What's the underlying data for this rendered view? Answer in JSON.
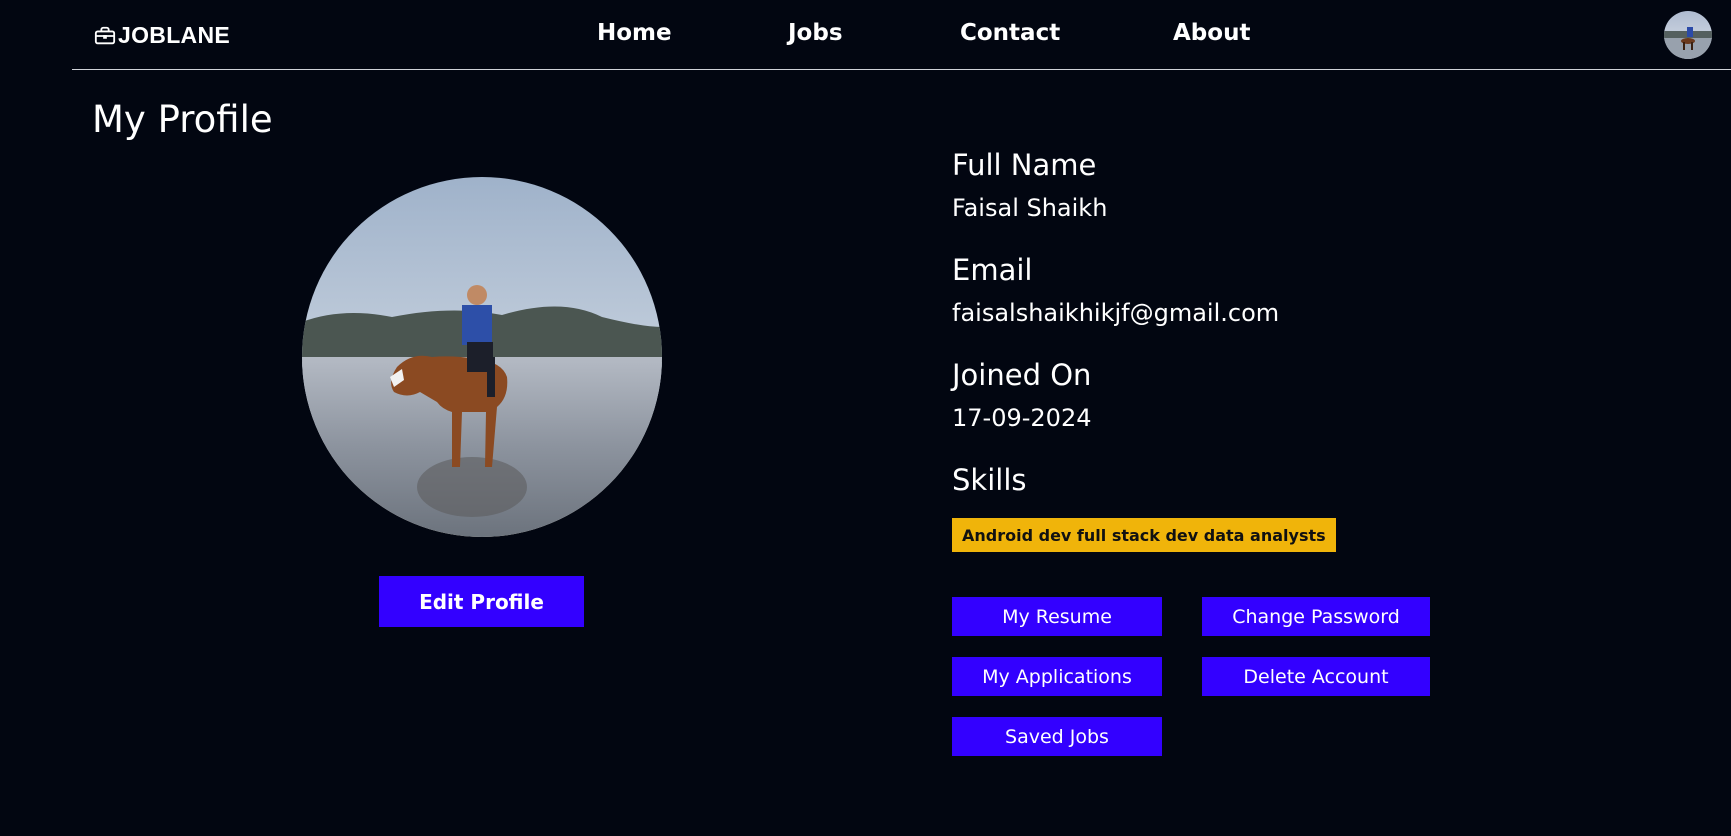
{
  "nav": {
    "brand": "JOBLANE",
    "links": [
      "Home",
      "Jobs",
      "Contact",
      "About"
    ]
  },
  "page": {
    "title": "My Profile"
  },
  "profile": {
    "fields": [
      {
        "label": "Full Name",
        "value": "Faisal Shaikh"
      },
      {
        "label": "Email",
        "value": "faisalshaikhikjf@gmail.com"
      },
      {
        "label": "Joined On",
        "value": "17-09-2024"
      }
    ],
    "skills_label": "Skills",
    "skills": [
      "Android dev full stack dev data analysts"
    ]
  },
  "buttons": {
    "edit_profile": "Edit Profile",
    "my_resume": "My Resume",
    "change_password": "Change Password",
    "my_applications": "My Applications",
    "delete_account": "Delete Account",
    "saved_jobs": "Saved Jobs"
  },
  "icons": {
    "brand": "briefcase-icon",
    "nav_avatar": "user-avatar-photo",
    "profile_photo": "profile-photo"
  },
  "colors": {
    "background": "#020611",
    "button": "#3300ff",
    "skill_tag": "#f0b40a",
    "text": "#ffffff"
  }
}
